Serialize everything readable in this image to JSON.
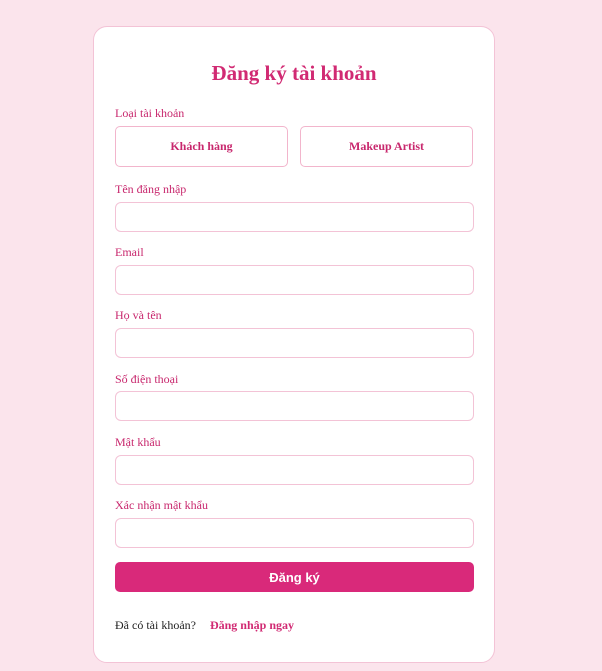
{
  "register": {
    "title": "Đăng ký tài khoản",
    "account_type": {
      "label": "Loại tài khoản",
      "options": [
        "Khách hàng",
        "Makeup Artist"
      ]
    },
    "fields": {
      "username": {
        "label": "Tên đăng nhập",
        "value": ""
      },
      "email": {
        "label": "Email",
        "value": ""
      },
      "fullname": {
        "label": "Họ và tên",
        "value": ""
      },
      "phone": {
        "label": "Số điện thoại",
        "value": ""
      },
      "password": {
        "label": "Mật khẩu",
        "value": ""
      },
      "confirm_password": {
        "label": "Xác nhận mật khẩu",
        "value": ""
      }
    },
    "submit_label": "Đăng ký",
    "footer": {
      "text": "Đã có tài khoản?",
      "link_label": "Đăng nhập ngay"
    }
  },
  "colors": {
    "page_background": "#fbe4ec",
    "accent": "#d9297a",
    "label_text": "#c8276d",
    "border": "#f3c3d6"
  }
}
